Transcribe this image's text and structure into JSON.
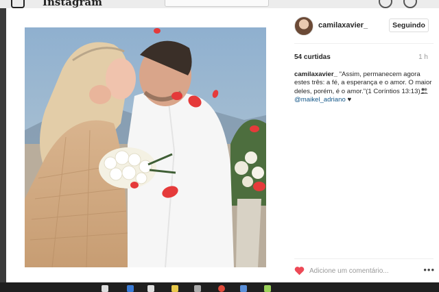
{
  "background": {
    "brand": "Instagram"
  },
  "post": {
    "username": "camilaxavier_",
    "follow_label": "Seguindo",
    "likes": "54 curtidas",
    "time": "1 h",
    "caption_user": "camilaxavier_",
    "caption_text": " \"Assim, permanecem agora estes três: a fé, a esperança e o amor. O maior deles, porém, é o amor.\"(1 Coríntios 13:13)",
    "caption_mention": "@maikel_adriano",
    "caption_end": " ♥",
    "comment_placeholder": "Adicione um comentário...",
    "more_label": "•••"
  },
  "icons": {
    "like": "heart-icon",
    "more": "more-options-icon",
    "tagged": "people-icon"
  },
  "colors": {
    "heart": "#ed4956",
    "mention": "#125688",
    "text": "#262626",
    "muted": "#999999"
  }
}
